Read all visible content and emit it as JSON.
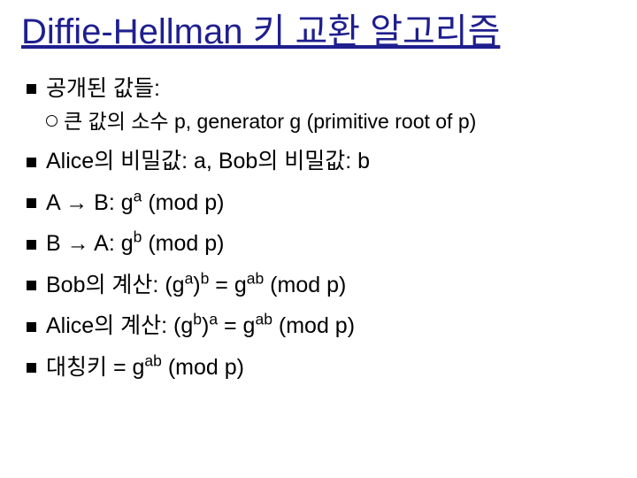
{
  "title": "Diffie-Hellman 키 교환 알고리즘",
  "items": [
    {
      "html": "공개된 값들:"
    },
    {
      "sub": true,
      "html": "큰 값의 소수 p, generator g (primitive root of p)"
    },
    {
      "html": "Alice의 비밀값: a, Bob의 비밀값: b"
    },
    {
      "html": "A → B: g<sup>a</sup> (mod p)"
    },
    {
      "html": "B → A: g<sup>b</sup> (mod p)"
    },
    {
      "html": "Bob의 계산: (g<sup>a</sup>)<sup>b</sup> = g<sup>ab</sup> (mod p)"
    },
    {
      "html": "Alice의 계산: (g<sup>b</sup>)<sup>a</sup> = g<sup>ab</sup> (mod p)"
    },
    {
      "html": "대칭키 = g<sup>ab</sup> (mod p)"
    }
  ]
}
